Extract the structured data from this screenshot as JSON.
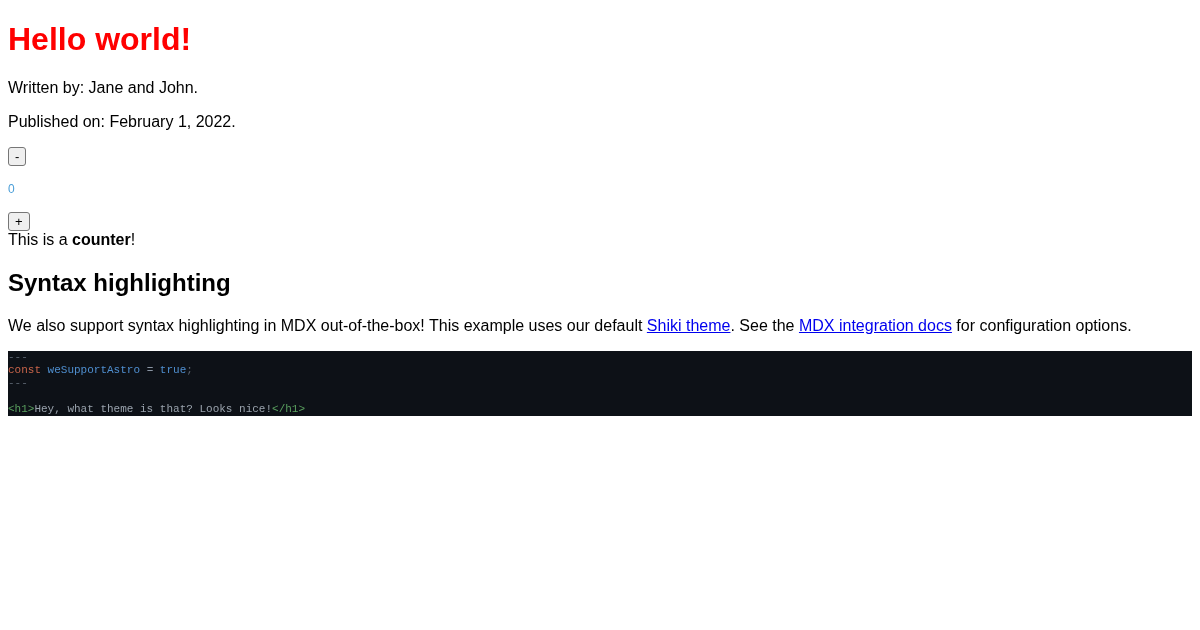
{
  "title": "Hello world!",
  "byline": "Written by: Jane and John.",
  "published": "Published on: February 1, 2022.",
  "counter": {
    "decrement": "-",
    "value": "0",
    "increment": "+",
    "caption": "This is a **counter**!"
  },
  "section_heading": "Syntax highlighting",
  "intro": [
    {
      "kind": "text",
      "text": "We also support syntax highlighting in MDX out-of-the-box! This example uses our default "
    },
    {
      "kind": "link",
      "text": "Shiki theme"
    },
    {
      "kind": "text",
      "text": ". See the "
    },
    {
      "kind": "link",
      "text": "MDX integration docs"
    },
    {
      "kind": "text",
      "text": " for configuration options."
    }
  ],
  "code_lines": [
    {
      "kind": "code",
      "tokens": [
        {
          "kind": "punct",
          "text": "---"
        }
      ]
    },
    {
      "kind": "code",
      "tokens": [
        {
          "kind": "keyword",
          "text": "const "
        },
        {
          "kind": "ident",
          "text": "weSupportAstro"
        },
        {
          "kind": "op",
          "text": " = "
        },
        {
          "kind": "ident",
          "text": "true"
        },
        {
          "kind": "punct",
          "text": ";"
        }
      ]
    },
    {
      "kind": "code",
      "tokens": [
        {
          "kind": "punct",
          "text": "---"
        }
      ]
    },
    {
      "kind": "blank"
    },
    {
      "kind": "code",
      "tokens": [
        {
          "kind": "tag",
          "text": "<h1>"
        },
        {
          "kind": "plain",
          "text": "Hey, what theme is that? Looks nice!"
        },
        {
          "kind": "tag",
          "text": "</h1>"
        }
      ]
    }
  ]
}
